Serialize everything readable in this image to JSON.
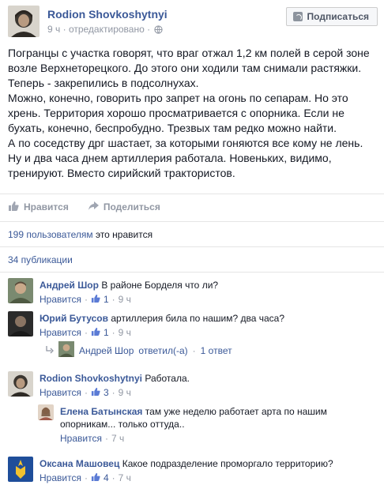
{
  "post": {
    "author": "Rodion Shovkoshytnyi",
    "time": "9 ч",
    "edited": "· отредактировано ·",
    "follow_label": "Подписаться",
    "body_lines": [
      "Погранцы с участка говорят, что враг отжал 1,2 км полей в серой зоне",
      "возле Верхнеторецкого. До этого они ходили там снимали растяжки.",
      "Теперь - закрепились в подсолнухах.",
      "Можно, конечно, говорить про запрет на огонь по сепарам. Но это",
      "хрень. Территория хорошо просматривается с опорника. Если не",
      "бухать, конечно, беспробудно. Трезвых там редко можно найти.",
      "А по соседству дрг шастает, за которыми гоняются все кому не лень.",
      "Ну и два часа днем артиллерия работала. Новеньких, видимо,",
      "тренируют. Вместо сирийский трактористов."
    ]
  },
  "actions": {
    "like": "Нравится",
    "share": "Поделиться"
  },
  "stats": {
    "likes_count": "199 пользователям",
    "likes_suffix": "это нравится",
    "shares": "34 публикации"
  },
  "comments": [
    {
      "name": "Андрей Шор",
      "text": "В районе Борделя что ли?",
      "like": "Нравится",
      "sep": "·",
      "count": "1",
      "time": "9 ч"
    },
    {
      "name": "Юрий Бутусов",
      "text": "артиллерия била по нашим? два часа?",
      "like": "Нравится",
      "sep": "·",
      "count": "1",
      "time": "9 ч"
    },
    {
      "name": "Rodion Shovkoshytnyi",
      "text": "Работала.",
      "like": "Нравится",
      "sep": "·",
      "count": "3",
      "time": "9 ч"
    },
    {
      "name": "Оксана Машовец",
      "text": "Какое подразделение проморгало территорию?",
      "like": "Нравится",
      "sep": "·",
      "count": "4",
      "time": "7 ч"
    }
  ],
  "reply_summary": {
    "name": "Андрей Шор",
    "action": "ответил(-а)",
    "dot": "·",
    "count": "1 ответ"
  },
  "nested_reply": {
    "name": "Елена Батынская",
    "text1": "там уже неделю работает арта по нашим",
    "text2": "опорникам... только оттуда..",
    "like": "Нравится",
    "dot": "·",
    "time": "7 ч"
  },
  "colors": {
    "link": "#3b5998",
    "muted": "#9197a3",
    "text": "#141823"
  }
}
